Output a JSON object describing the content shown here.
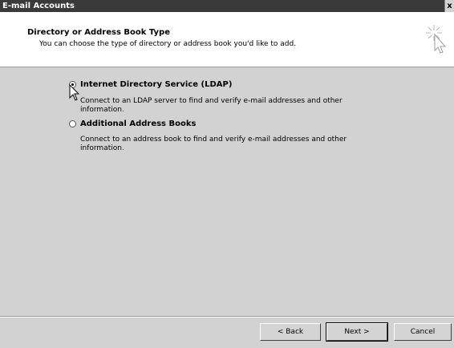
{
  "window": {
    "title": "E-mail Accounts",
    "close_glyph": "x"
  },
  "header": {
    "title": "Directory or Address Book Type",
    "subtitle": "You can choose the type of directory or address book you'd like to add.",
    "icon": "wizard-sparkle-cursor-icon"
  },
  "options": [
    {
      "label": "Internet Directory Service (LDAP)",
      "description": "Connect to an LDAP server to find and verify e-mail addresses and other information.",
      "selected": true
    },
    {
      "label": "Additional Address Books",
      "description": "Connect to an address book to find and verify e-mail addresses and other information.",
      "selected": false
    }
  ],
  "buttons": {
    "back": "< Back",
    "next": "Next >",
    "cancel": "Cancel"
  }
}
